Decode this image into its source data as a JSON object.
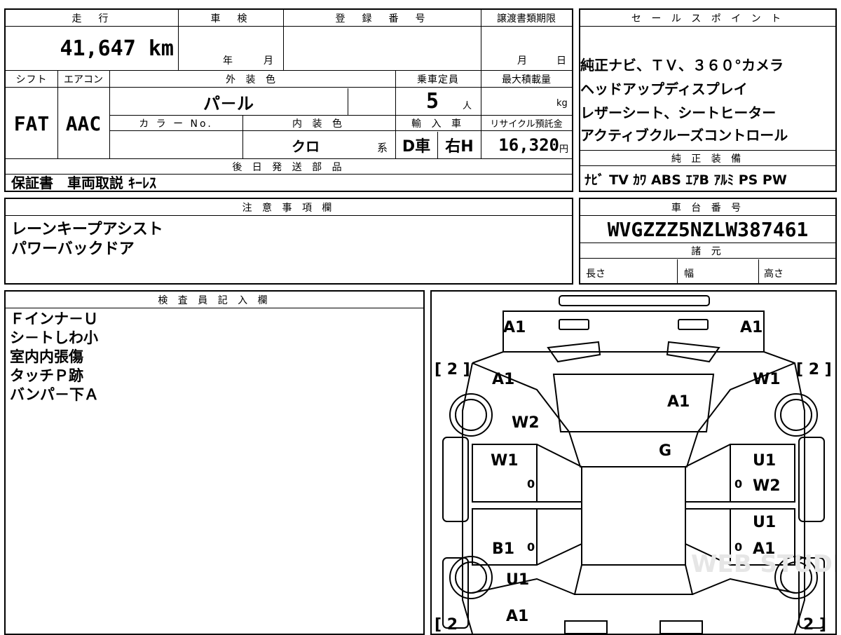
{
  "top": {
    "mileage_h": "走　行",
    "mileage": "41,647 km",
    "shaken_h": "車　検",
    "shaken_y": "年",
    "shaken_m": "月",
    "reg_h": "登　録　番　号",
    "transfer_h": "譲渡書類期限",
    "transfer_m": "月",
    "transfer_d": "日",
    "shift_h": "シフト",
    "shift": "FAT",
    "ac_h": "エアコン",
    "ac": "AAC",
    "ext_h": "外 装 色",
    "ext": "パ－ル",
    "cap_h": "乗車定員",
    "cap": "5",
    "cap_unit": "人",
    "load_h": "最大積載量",
    "load_unit": "kg",
    "colorno_h": "カ ラ ー No.",
    "int_h": "内 装 色",
    "int": "クロ",
    "int_unit": "系",
    "import_h": "輸 入 車",
    "import_a": "D車",
    "import_b": "右H",
    "recycle_h": "リサイクル預託金",
    "recycle": "16,320",
    "recycle_unit": "円",
    "later_h": "後 日 発 送 部 品",
    "later": "保証書　車両取説 ｷｰﾚｽ"
  },
  "sale": {
    "h": "セ ー ル ス ポ イ ン ト",
    "lines": [
      "純正ナビ、ＴＶ、３６０°カメラ",
      "ヘッドアップディスプレイ",
      "レザーシート、シートヒーター",
      "アクティブクルーズコントロール"
    ],
    "equip_h": "純 正 装 備",
    "equip": "ﾅﾋﾞ TV ｶﾜ ABS ｴｱB ｱﾙﾐ PS PW"
  },
  "notes": {
    "h": "注 意 事 項 欄",
    "lines": [
      "レーンキープアシスト",
      "パワーバックドア"
    ]
  },
  "chassis": {
    "h": "車 台 番 号",
    "vin": "WVGZZZ5NZLW387461",
    "spec_h": "諸 元",
    "len": "長さ",
    "wid": "幅",
    "hgt": "高さ"
  },
  "inspector": {
    "h": "検 査 員 記 入 欄",
    "lines": [
      "Ｆインナ－Ｕ",
      "シ－トしわ小",
      "室内内張傷",
      "タッチＰ跡",
      "バンパ－下Ａ"
    ]
  },
  "diagram": {
    "marks": [
      "A1",
      "A1",
      "A1",
      "W1",
      "A1",
      "W2",
      "G",
      "W1",
      "U1",
      "W2",
      "U1",
      "B1",
      "A1",
      "U1",
      "A1"
    ],
    "zeros": [
      "0",
      "0",
      "0",
      "0"
    ],
    "tires": [
      "[ 2 ]",
      "[ 2 ]",
      "[ 2",
      "2 ]"
    ],
    "watermark": "WEB STUDIO PRO"
  }
}
